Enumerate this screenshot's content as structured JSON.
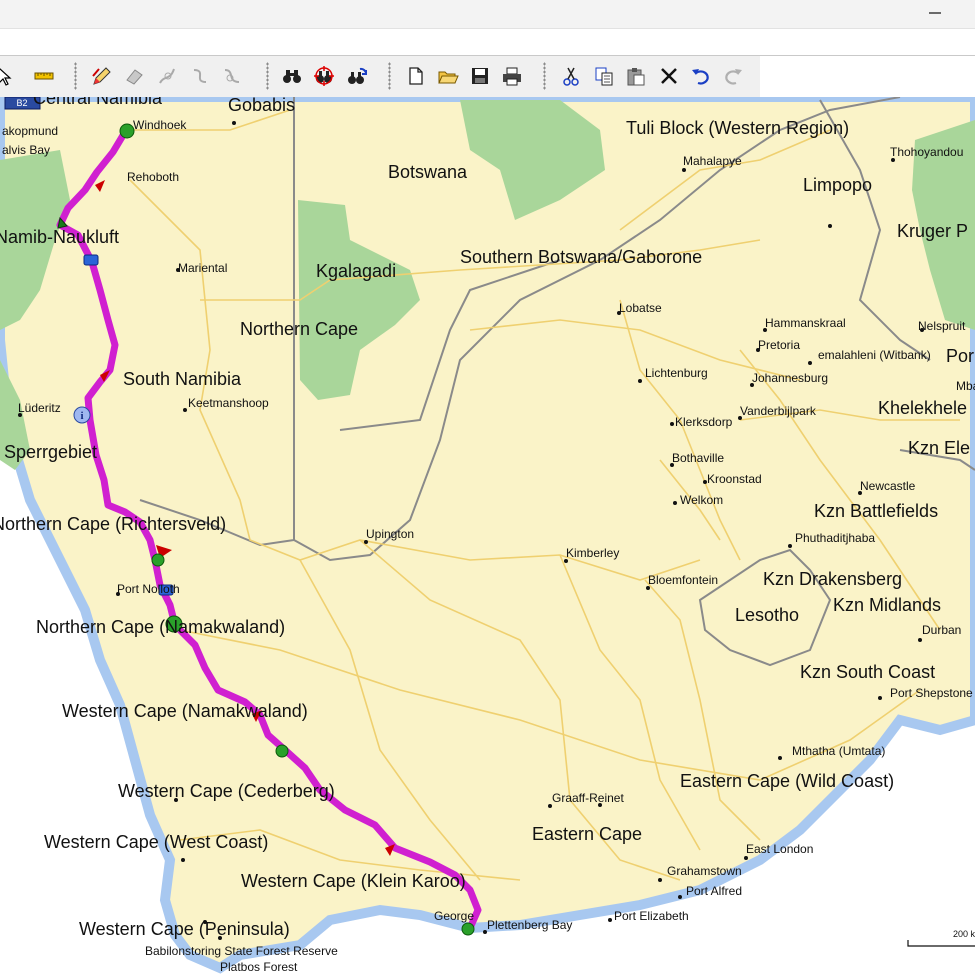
{
  "window": {
    "minimize_icon": "minimize-icon"
  },
  "toolbar": {
    "tools": [
      {
        "name": "select-tool",
        "icon": "arrow-icon"
      },
      {
        "name": "measure-tool",
        "icon": "ruler-icon"
      },
      {
        "name": "draw-route-tool",
        "icon": "pencil-icon"
      },
      {
        "name": "erase-tool",
        "icon": "eraser-icon"
      },
      {
        "name": "route-tool-1",
        "icon": "route-icon"
      },
      {
        "name": "route-tool-2",
        "icon": "route-icon"
      },
      {
        "name": "route-tool-3",
        "icon": "route-icon"
      },
      {
        "name": "find-tool",
        "icon": "binoculars-icon"
      },
      {
        "name": "find-nearby-tool",
        "icon": "binoculars-target-icon"
      },
      {
        "name": "find-again-tool",
        "icon": "binoculars-refresh-icon"
      },
      {
        "name": "new-button",
        "icon": "new-file-icon"
      },
      {
        "name": "open-button",
        "icon": "folder-icon"
      },
      {
        "name": "save-button",
        "icon": "disk-icon"
      },
      {
        "name": "print-button",
        "icon": "printer-icon"
      },
      {
        "name": "cut-button",
        "icon": "scissors-icon"
      },
      {
        "name": "copy-button",
        "icon": "copy-icon"
      },
      {
        "name": "paste-button",
        "icon": "clipboard-icon"
      },
      {
        "name": "delete-button",
        "icon": "close-icon"
      },
      {
        "name": "undo-button",
        "icon": "undo-icon"
      },
      {
        "name": "redo-button",
        "icon": "redo-icon"
      }
    ]
  },
  "map": {
    "shield": "B2",
    "regions": [
      "Central Namibia",
      "Gobabis",
      "Tuli Block (Western Region)",
      "Botswana",
      "Limpopo",
      "Kruger P",
      "Namib-Naukluft",
      "Kgalagadi",
      "Southern Botswana/Gaborone",
      "Northern Cape",
      "South Namibia",
      "Sperrgebiet",
      "Northern Cape (Richtersveld)",
      "Kzn Battlefields",
      "Kzn Drakensberg",
      "Kzn Midlands",
      "Lesotho",
      "Northern Cape (Namakwaland)",
      "Kzn South Coast",
      "Western Cape (Namakwaland)",
      "Western Cape (Cederberg)",
      "Eastern Cape (Wild Coast)",
      "Western Cape (West Coast)",
      "Eastern Cape",
      "Western Cape (Klein Karoo)",
      "Western Cape (Peninsula)",
      "Khelekhele",
      "Kzn Ele",
      "Por"
    ],
    "cities": [
      "akopmund",
      "alvis Bay",
      "Windhoek",
      "Rehoboth",
      "Mahalapye",
      "Thohoyandou",
      "Mariental",
      "Lobatse",
      "Hammanskraal",
      "Nelspruit",
      "Pretoria",
      "emalahleni (Witbank)",
      "Lichtenburg",
      "Johannesburg",
      "Mbaban",
      "Keetmanshoop",
      "Lüderitz",
      "Vanderbijlpark",
      "Klerksdorp",
      "Bothaville",
      "Kroonstad",
      "Welkom",
      "Newcastle",
      "Upington",
      "Phuthaditjhaba",
      "Kimberley",
      "Bloemfontein",
      "Port Nolloth",
      "Durban",
      "Port Shepstone",
      "Mthatha (Umtata)",
      "Graaff-Reinet",
      "East London",
      "Grahamstown",
      "Port Alfred",
      "Port Elizabeth",
      "George",
      "Plettenberg Bay",
      "Babilonstoring State Forest Reserve",
      "Platbos Forest"
    ],
    "scale_label": "200 k",
    "colors": {
      "land": "#faf3c8",
      "water": "#a8c8f0",
      "park": "#a9d69a",
      "route": "#d020d0",
      "road": "#efd070",
      "border": "#8a8a8a"
    }
  }
}
